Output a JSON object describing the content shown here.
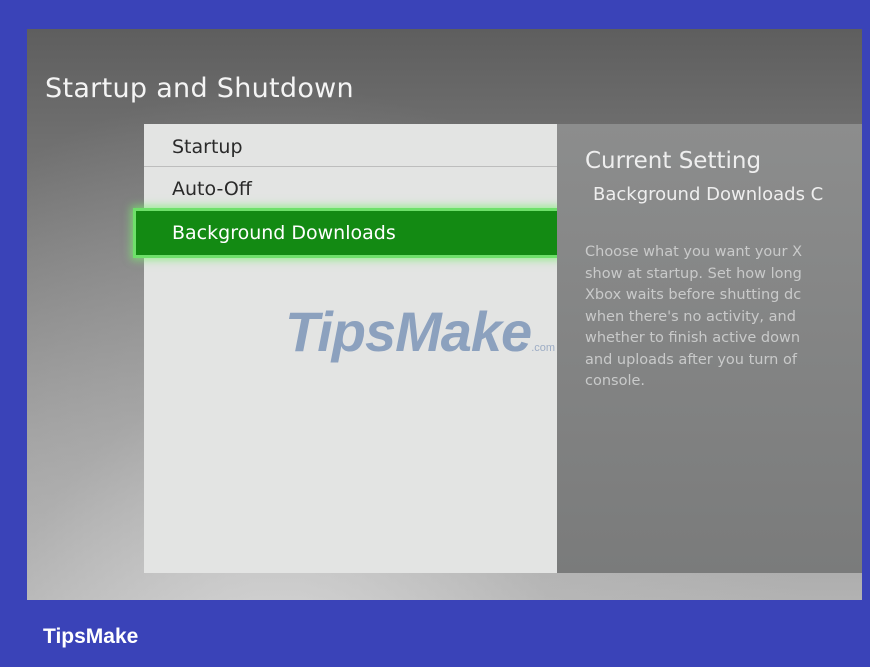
{
  "screen": {
    "title": "Startup and Shutdown",
    "menu": {
      "items": [
        {
          "label": "Startup"
        },
        {
          "label": "Auto-Off"
        },
        {
          "label": "Background Downloads"
        }
      ],
      "selected": "Background Downloads"
    },
    "info": {
      "heading": "Current Setting",
      "value": "Background Downloads C",
      "description_lines": [
        "Choose what you want your X",
        "show at startup. Set how long",
        "Xbox waits before shutting dc",
        "when there's no activity, and  ",
        "whether to finish active down",
        "and uploads after you turn of",
        "console."
      ]
    }
  },
  "watermark": {
    "text": "TipsMake",
    "domain": ".com"
  },
  "brand": {
    "label": "TipsMake"
  },
  "colors": {
    "frame": "#3a43b8",
    "selected_item": "#138a13",
    "selected_glow": "#6ee06a"
  }
}
